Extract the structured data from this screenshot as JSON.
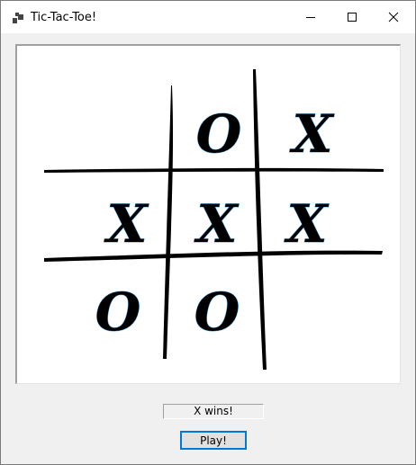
{
  "window": {
    "title": "Tic-Tac-Toe!",
    "icon": "app-window-icon",
    "controls": [
      "minimize-icon",
      "maximize-icon",
      "close-icon"
    ]
  },
  "board": {
    "cells": [
      [
        "",
        "O",
        "X"
      ],
      [
        "X",
        "X",
        "X"
      ],
      [
        "O",
        "O",
        ""
      ]
    ]
  },
  "status": {
    "text": "X wins!"
  },
  "play_button": {
    "label": "Play!"
  },
  "colors": {
    "accent": "#0078d7",
    "background": "#f0f0f0",
    "board": "#ffffff"
  }
}
